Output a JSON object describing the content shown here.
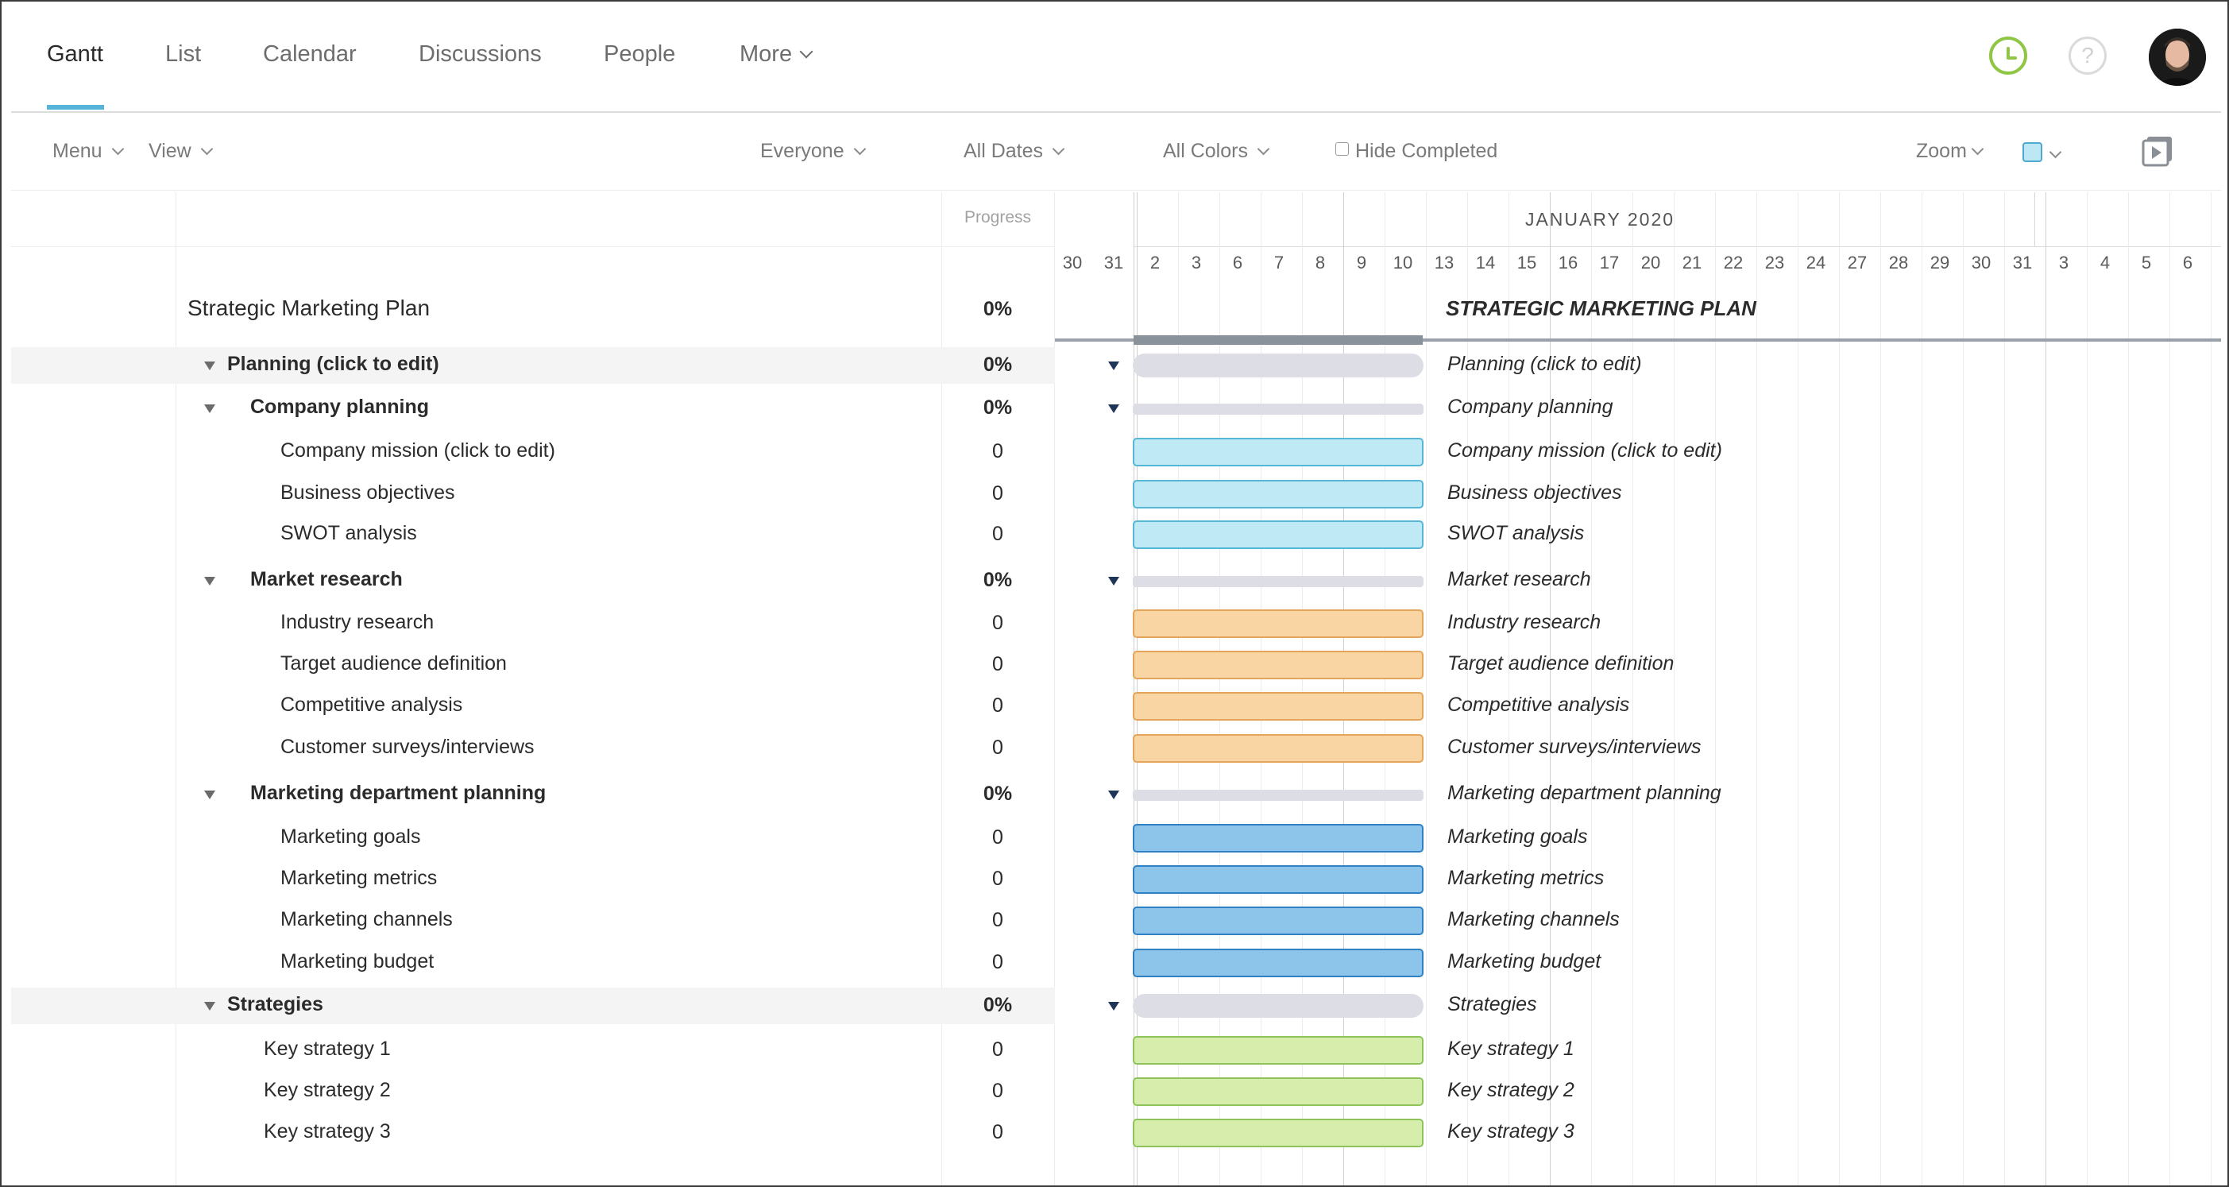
{
  "nav": {
    "tabs": [
      {
        "label": "Gantt",
        "active": true
      },
      {
        "label": "List",
        "active": false
      },
      {
        "label": "Calendar",
        "active": false
      },
      {
        "label": "Discussions",
        "active": false
      },
      {
        "label": "People",
        "active": false
      },
      {
        "label": "More",
        "active": false
      }
    ],
    "help_label": "?"
  },
  "toolbar": {
    "menu_label": "Menu",
    "view_label": "View",
    "everyone_label": "Everyone",
    "dates_label": "All Dates",
    "colors_label": "All Colors",
    "hide_completed_label": "Hide Completed",
    "zoom_label": "Zoom",
    "selected_color": "#bde7f4"
  },
  "columns": {
    "progress_header": "Progress"
  },
  "timeline": {
    "month_label": "JANUARY 2020",
    "days": [
      "30",
      "31",
      "2",
      "3",
      "6",
      "7",
      "8",
      "9",
      "10",
      "13",
      "14",
      "15",
      "16",
      "17",
      "20",
      "21",
      "22",
      "23",
      "24",
      "27",
      "28",
      "29",
      "30",
      "31",
      "3",
      "4",
      "5",
      "6"
    ]
  },
  "project": {
    "name": "Strategic Marketing Plan",
    "progress": "0%",
    "bar_label": "STRATEGIC MARKETING PLAN"
  },
  "rows": [
    {
      "name": "Planning (click to edit)",
      "progress": "0%",
      "kind": "group",
      "label": "Planning (click to edit)"
    },
    {
      "name": "Company planning",
      "progress": "0%",
      "kind": "subgroup",
      "label": "Company planning"
    },
    {
      "name": "Company mission (click to edit)",
      "progress": "0",
      "kind": "task",
      "color": "c-blue-light",
      "label": "Company mission (click to edit)"
    },
    {
      "name": "Business objectives",
      "progress": "0",
      "kind": "task",
      "color": "c-blue-light",
      "label": "Business objectives"
    },
    {
      "name": "SWOT analysis",
      "progress": "0",
      "kind": "task",
      "color": "c-blue-light",
      "label": "SWOT analysis"
    },
    {
      "name": "Market research",
      "progress": "0%",
      "kind": "subgroup",
      "label": "Market research"
    },
    {
      "name": "Industry research",
      "progress": "0",
      "kind": "task",
      "color": "c-orange",
      "label": "Industry research"
    },
    {
      "name": "Target audience definition",
      "progress": "0",
      "kind": "task",
      "color": "c-orange",
      "label": "Target audience definition"
    },
    {
      "name": "Competitive analysis",
      "progress": "0",
      "kind": "task",
      "color": "c-orange",
      "label": "Competitive analysis"
    },
    {
      "name": "Customer surveys/interviews",
      "progress": "0",
      "kind": "task",
      "color": "c-orange",
      "label": "Customer surveys/interviews"
    },
    {
      "name": "Marketing department planning",
      "progress": "0%",
      "kind": "subgroup",
      "label": "Marketing department planning"
    },
    {
      "name": "Marketing goals",
      "progress": "0",
      "kind": "task",
      "color": "c-blue",
      "label": "Marketing goals"
    },
    {
      "name": "Marketing metrics",
      "progress": "0",
      "kind": "task",
      "color": "c-blue",
      "label": "Marketing metrics"
    },
    {
      "name": "Marketing channels",
      "progress": "0",
      "kind": "task",
      "color": "c-blue",
      "label": "Marketing channels"
    },
    {
      "name": "Marketing budget",
      "progress": "0",
      "kind": "task",
      "color": "c-blue",
      "label": "Marketing budget"
    },
    {
      "name": "Strategies",
      "progress": "0%",
      "kind": "group",
      "label": "Strategies"
    },
    {
      "name": "Key strategy 1",
      "progress": "0",
      "kind": "task2",
      "color": "c-green",
      "label": "Key strategy 1"
    },
    {
      "name": "Key strategy 2",
      "progress": "0",
      "kind": "task2",
      "color": "c-green",
      "label": "Key strategy 2"
    },
    {
      "name": "Key strategy 3",
      "progress": "0",
      "kind": "task2",
      "color": "c-green",
      "label": "Key strategy 3"
    }
  ],
  "colors": {
    "accent": "#58b3d9",
    "clock_green": "#8fc645",
    "task_light_blue": "#bfe9f5",
    "task_orange": "#f8d5a2",
    "task_blue": "#8dc5ea",
    "task_green": "#d6edac"
  },
  "icons": {
    "clock": "clock-icon",
    "help": "help-icon",
    "play": "play-icon",
    "caret": "chevron-down-icon",
    "collapse": "triangle-down-icon"
  }
}
